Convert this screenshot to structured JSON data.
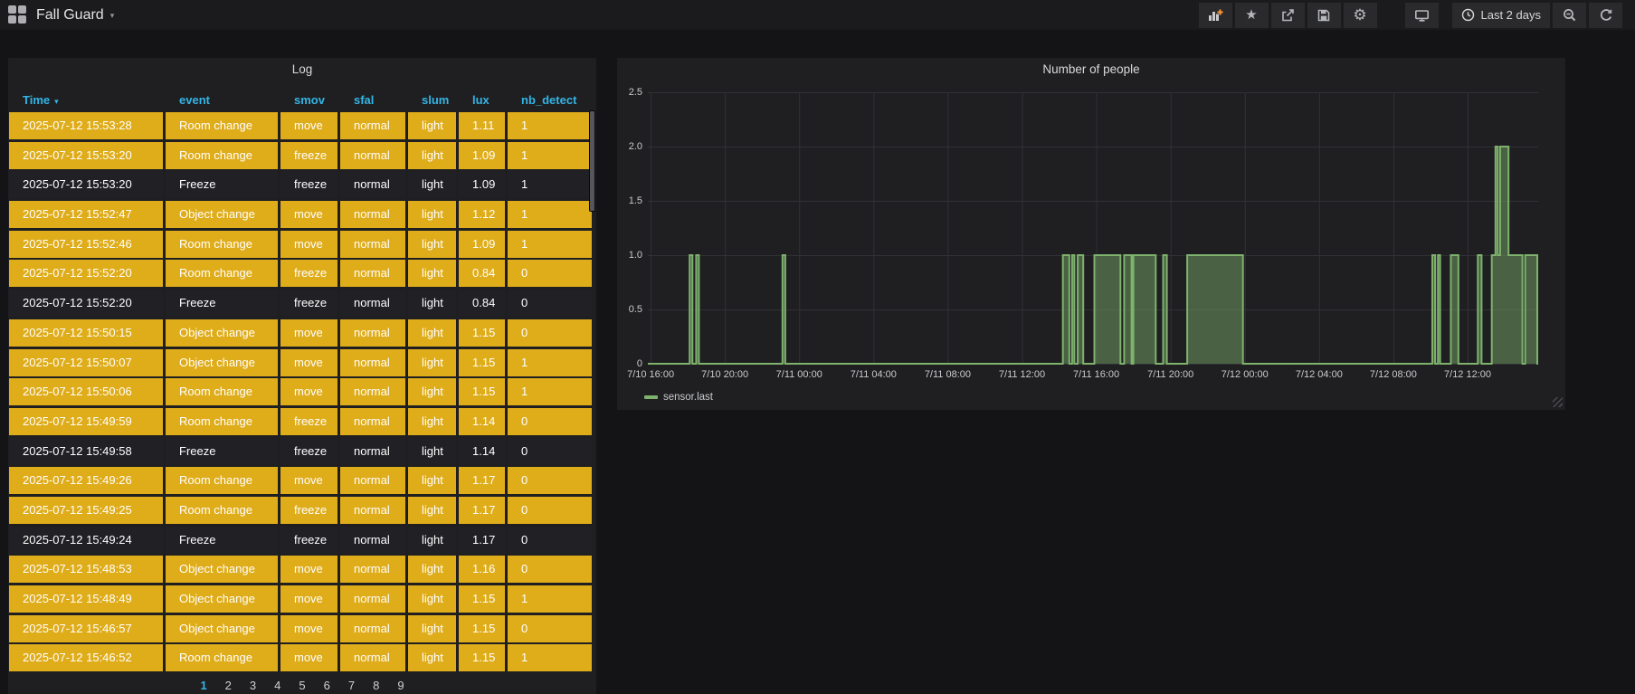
{
  "navbar": {
    "title": "Fall Guard",
    "time_range_label": "Last 2 days",
    "icons": [
      "dashboard-grid",
      "add-panel",
      "star",
      "share",
      "save",
      "settings",
      "cycle-view",
      "clock",
      "zoom-out",
      "refresh"
    ]
  },
  "log_panel": {
    "title": "Log",
    "columns": [
      {
        "key": "time",
        "label": "Time",
        "sorted": "desc"
      },
      {
        "key": "event",
        "label": "event"
      },
      {
        "key": "smov",
        "label": "smov"
      },
      {
        "key": "sfal",
        "label": "sfal"
      },
      {
        "key": "slum",
        "label": "slum"
      },
      {
        "key": "lux",
        "label": "lux"
      },
      {
        "key": "nb_detect",
        "label": "nb_detect"
      }
    ],
    "highlight_color": "#dfac1a",
    "rows": [
      {
        "time": "2025-07-12 15:53:28",
        "event": "Room change",
        "smov": "move",
        "sfal": "normal",
        "slum": "light",
        "lux": "1.11",
        "nb_detect": "1",
        "highlighted": true
      },
      {
        "time": "2025-07-12 15:53:20",
        "event": "Room change",
        "smov": "freeze",
        "sfal": "normal",
        "slum": "light",
        "lux": "1.09",
        "nb_detect": "1",
        "highlighted": true
      },
      {
        "time": "2025-07-12 15:53:20",
        "event": "Freeze",
        "smov": "freeze",
        "sfal": "normal",
        "slum": "light",
        "lux": "1.09",
        "nb_detect": "1",
        "highlighted": false
      },
      {
        "time": "2025-07-12 15:52:47",
        "event": "Object change",
        "smov": "move",
        "sfal": "normal",
        "slum": "light",
        "lux": "1.12",
        "nb_detect": "1",
        "highlighted": true
      },
      {
        "time": "2025-07-12 15:52:46",
        "event": "Room change",
        "smov": "move",
        "sfal": "normal",
        "slum": "light",
        "lux": "1.09",
        "nb_detect": "1",
        "highlighted": true
      },
      {
        "time": "2025-07-12 15:52:20",
        "event": "Room change",
        "smov": "freeze",
        "sfal": "normal",
        "slum": "light",
        "lux": "0.84",
        "nb_detect": "0",
        "highlighted": true
      },
      {
        "time": "2025-07-12 15:52:20",
        "event": "Freeze",
        "smov": "freeze",
        "sfal": "normal",
        "slum": "light",
        "lux": "0.84",
        "nb_detect": "0",
        "highlighted": false
      },
      {
        "time": "2025-07-12 15:50:15",
        "event": "Object change",
        "smov": "move",
        "sfal": "normal",
        "slum": "light",
        "lux": "1.15",
        "nb_detect": "0",
        "highlighted": true
      },
      {
        "time": "2025-07-12 15:50:07",
        "event": "Object change",
        "smov": "move",
        "sfal": "normal",
        "slum": "light",
        "lux": "1.15",
        "nb_detect": "1",
        "highlighted": true
      },
      {
        "time": "2025-07-12 15:50:06",
        "event": "Room change",
        "smov": "move",
        "sfal": "normal",
        "slum": "light",
        "lux": "1.15",
        "nb_detect": "1",
        "highlighted": true
      },
      {
        "time": "2025-07-12 15:49:59",
        "event": "Room change",
        "smov": "freeze",
        "sfal": "normal",
        "slum": "light",
        "lux": "1.14",
        "nb_detect": "0",
        "highlighted": true
      },
      {
        "time": "2025-07-12 15:49:58",
        "event": "Freeze",
        "smov": "freeze",
        "sfal": "normal",
        "slum": "light",
        "lux": "1.14",
        "nb_detect": "0",
        "highlighted": false
      },
      {
        "time": "2025-07-12 15:49:26",
        "event": "Room change",
        "smov": "move",
        "sfal": "normal",
        "slum": "light",
        "lux": "1.17",
        "nb_detect": "0",
        "highlighted": true
      },
      {
        "time": "2025-07-12 15:49:25",
        "event": "Room change",
        "smov": "freeze",
        "sfal": "normal",
        "slum": "light",
        "lux": "1.17",
        "nb_detect": "0",
        "highlighted": true
      },
      {
        "time": "2025-07-12 15:49:24",
        "event": "Freeze",
        "smov": "freeze",
        "sfal": "normal",
        "slum": "light",
        "lux": "1.17",
        "nb_detect": "0",
        "highlighted": false
      },
      {
        "time": "2025-07-12 15:48:53",
        "event": "Object change",
        "smov": "move",
        "sfal": "normal",
        "slum": "light",
        "lux": "1.16",
        "nb_detect": "0",
        "highlighted": true
      },
      {
        "time": "2025-07-12 15:48:49",
        "event": "Object change",
        "smov": "move",
        "sfal": "normal",
        "slum": "light",
        "lux": "1.15",
        "nb_detect": "1",
        "highlighted": true
      },
      {
        "time": "2025-07-12 15:46:57",
        "event": "Object change",
        "smov": "move",
        "sfal": "normal",
        "slum": "light",
        "lux": "1.15",
        "nb_detect": "0",
        "highlighted": true
      },
      {
        "time": "2025-07-12 15:46:52",
        "event": "Room change",
        "smov": "move",
        "sfal": "normal",
        "slum": "light",
        "lux": "1.15",
        "nb_detect": "1",
        "highlighted": true
      }
    ],
    "pagination": {
      "pages": [
        "1",
        "2",
        "3",
        "4",
        "5",
        "6",
        "7",
        "8",
        "9"
      ],
      "active": "1"
    }
  },
  "chart_data": {
    "type": "area",
    "step": true,
    "title": "Number of people",
    "legend": [
      "sensor.last"
    ],
    "ylim": [
      0,
      2.5
    ],
    "yticks": [
      0,
      0.5,
      1.0,
      1.5,
      2.0,
      2.5
    ],
    "ytick_labels": [
      "0",
      "0.5",
      "1.0",
      "1.5",
      "2.0",
      "2.5"
    ],
    "x_origin": "2025-07-10 16:00",
    "xlim_hours": [
      -0.15,
      47.8
    ],
    "xticks_hours": [
      0,
      4,
      8,
      12,
      16,
      20,
      24,
      28,
      32,
      36,
      40,
      44
    ],
    "xtick_labels": [
      "7/10 16:00",
      "7/10 20:00",
      "7/11 00:00",
      "7/11 04:00",
      "7/11 08:00",
      "7/11 12:00",
      "7/11 16:00",
      "7/11 20:00",
      "7/12 00:00",
      "7/12 04:00",
      "7/12 08:00",
      "7/12 12:00"
    ],
    "segments_hours": [
      [
        2.1,
        2.25,
        1
      ],
      [
        2.45,
        2.6,
        1
      ],
      [
        7.1,
        7.25,
        1
      ],
      [
        22.2,
        22.55,
        1
      ],
      [
        22.7,
        22.82,
        1
      ],
      [
        23.0,
        23.3,
        1
      ],
      [
        23.9,
        25.3,
        1
      ],
      [
        25.5,
        25.9,
        1
      ],
      [
        26.0,
        27.2,
        1
      ],
      [
        27.6,
        27.8,
        1
      ],
      [
        28.9,
        31.9,
        1
      ],
      [
        42.1,
        42.25,
        1
      ],
      [
        42.4,
        42.52,
        1
      ],
      [
        43.1,
        43.5,
        1
      ],
      [
        44.55,
        44.75,
        1
      ],
      [
        45.3,
        45.5,
        1
      ],
      [
        45.5,
        45.62,
        2
      ],
      [
        45.62,
        45.75,
        1
      ],
      [
        45.75,
        46.2,
        2
      ],
      [
        46.2,
        46.95,
        1
      ],
      [
        47.1,
        47.75,
        1
      ]
    ],
    "line_color": "#7eb26d",
    "fill_color": "rgba(126,178,109,0.45)",
    "grid": true,
    "legend_position": "bottom-left"
  }
}
